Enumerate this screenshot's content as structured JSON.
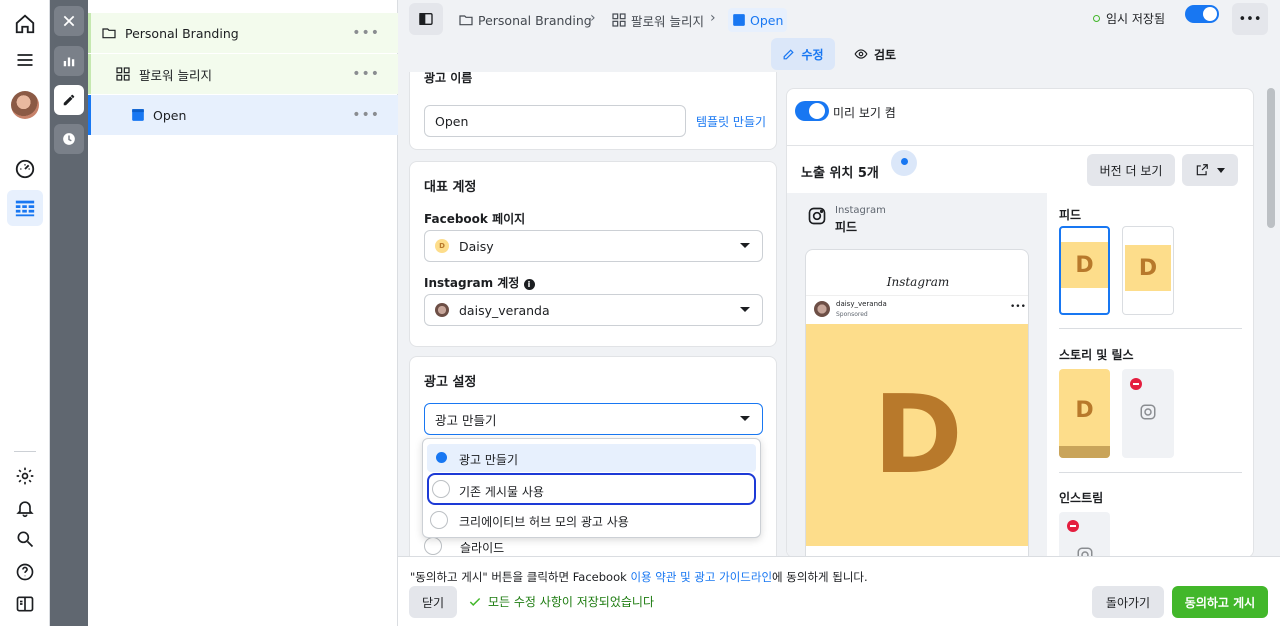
{
  "tree": {
    "items": [
      {
        "label": "Personal Branding"
      },
      {
        "label": "팔로워 늘리지"
      },
      {
        "label": "Open"
      }
    ]
  },
  "breadcrumb": [
    "Personal Branding",
    "팔로워 늘리지",
    "Open"
  ],
  "status": {
    "saved": "임시 저장됨"
  },
  "tabs": {
    "edit": "수정",
    "review": "검토"
  },
  "ad_name": {
    "value": "Open",
    "template_link": "템플릿 만들기",
    "header_partial": "광고 이름"
  },
  "identity": {
    "title": "대표 계정",
    "fb_label": "Facebook 페이지",
    "fb_value": "Daisy",
    "ig_label": "Instagram 계정",
    "ig_value": "daisy_veranda"
  },
  "ad_setup": {
    "title": "광고 설정",
    "selected": "광고 만들기",
    "options": [
      "광고 만들기",
      "기존 게시물 사용",
      "크리에이티브 허브 모의 광고 사용"
    ],
    "below_option": "슬라이드"
  },
  "preview": {
    "toggle_label": "미리 보기 켬",
    "placements_title": "노출 위치 5개",
    "more_versions": "버전 더 보기",
    "platform": "Instagram",
    "placement": "피드",
    "ig_logo": "Instagram",
    "account": "daisy_veranda",
    "sponsored": "Sponsored",
    "letter": "D",
    "sections": {
      "feed": "피드",
      "stories": "스토리 및 릴스",
      "instream": "인스트림"
    }
  },
  "footer": {
    "notice_pre": "\"동의하고 게시\" 버튼을 클릭하면 Facebook ",
    "notice_link": "이용 약관 및 광고 가이드라인",
    "notice_post": "에 동의하게 됩니다.",
    "close": "닫기",
    "saved_msg": "모든 수정 사항이 저장되었습니다",
    "back": "돌아가기",
    "publish": "동의하고 게시"
  },
  "colors": {
    "accent": "#1877f2",
    "green": "#42b72a",
    "ad_bg": "#fddd8b",
    "ad_letter": "#b8792b"
  }
}
